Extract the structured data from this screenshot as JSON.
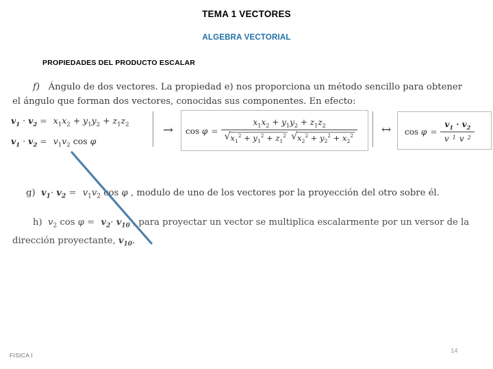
{
  "slide": {
    "title": "TEMA 1 VECTORES",
    "subtitle": "ALGEBRA VECTORIAL",
    "section_heading": "PROPIEDADES DEL PRODUCTO ESCALAR",
    "accent_color": "#1F6FA8",
    "line_color": "#4F7FA8",
    "background_color": "#FFFFFF"
  },
  "content": {
    "item_f": {
      "label": "f)",
      "line1": "Ángulo de dos vectores. La propiedad e) nos proporciona un método sencillo para obtener",
      "line2": "el ángulo que forman dos vectores, conocidas sus componentes. En efecto:"
    },
    "equations": {
      "left_line1": "v₁ · v₂ = x₁x₂ + y₁y₂ + z₁z₂",
      "left_line2": "v₁ · v₂ = v₁v₂ cos φ",
      "arrow_1": "→",
      "arrow_2": "↔",
      "center": {
        "cos_label": "cos φ",
        "equals": "=",
        "numerator": "x₁x₂ + y₁y₂ + z₁z₂",
        "denominator_left": "√(x₁² + y₁² + z₁²)",
        "denominator_right": "√(x₂² + y₂² + x₂²)"
      },
      "right": {
        "cos_label": "cos φ",
        "equals": "=",
        "numerator": "v₁ · v₂",
        "denominator": "v₁v₂"
      }
    },
    "item_g": {
      "label": "g)",
      "text": "v₁ · v₂ = v₁v₂ cos φ , modulo de uno de los vectores por la proyección del otro sobre él."
    },
    "item_h": {
      "label": "h)",
      "line1": "v₂ cos φ = v₂ · v₁₀ , para proyectar un vector se multiplica escalarmente por un versor de la",
      "line2": "dirección proyectante, v₁₀."
    }
  },
  "footer": {
    "course": "FISICA I",
    "page_number": "14"
  }
}
